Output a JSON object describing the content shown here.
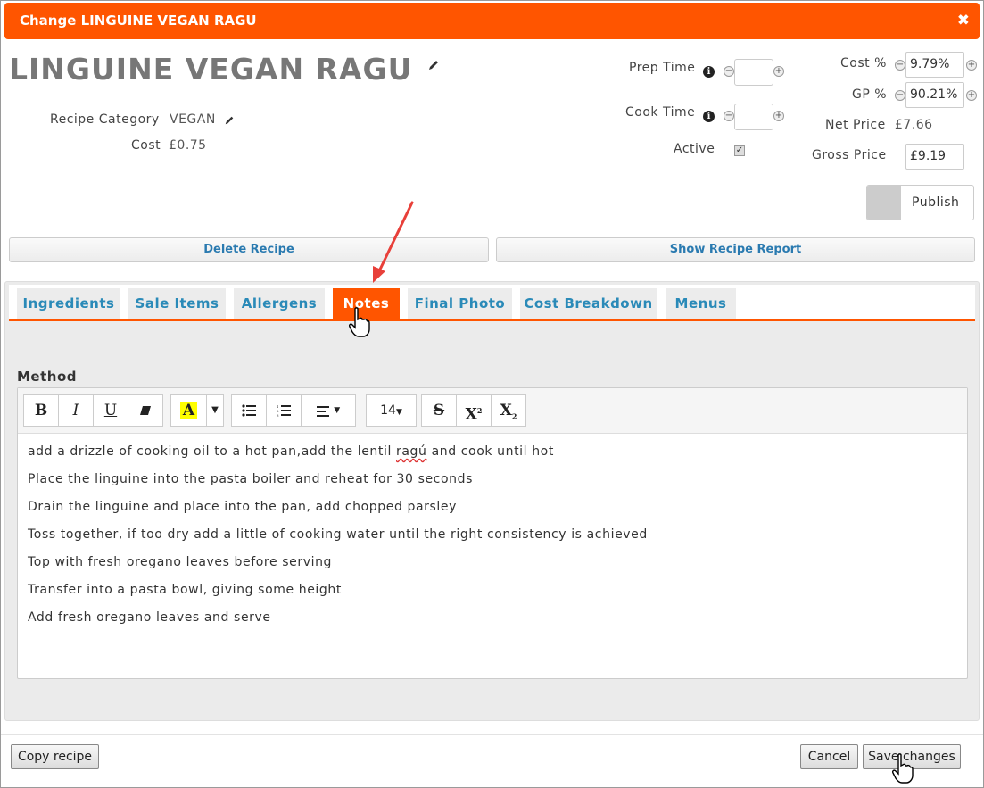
{
  "dialog": {
    "title": "Change LINGUINE VEGAN RAGU",
    "close_glyph": "✖"
  },
  "recipe": {
    "name": "LINGUINE VEGAN RAGU",
    "category_label": "Recipe Category",
    "category_value": "VEGAN",
    "cost_label": "Cost",
    "cost_value": "£0.75"
  },
  "timing": {
    "prep_label": "Prep Time",
    "prep_value": "",
    "cook_label": "Cook Time",
    "cook_value": "",
    "active_label": "Active",
    "active_checked": true
  },
  "pricing": {
    "cost_pct_label": "Cost %",
    "cost_pct_value": "9.79%",
    "gp_pct_label": "GP %",
    "gp_pct_value": "90.21%",
    "net_price_label": "Net Price",
    "net_price_value": "£7.66",
    "gross_price_label": "Gross Price",
    "gross_price_value": "£9.19"
  },
  "publish": {
    "label": "Publish"
  },
  "actions": {
    "delete": "Delete Recipe",
    "report": "Show Recipe Report"
  },
  "tabs": [
    {
      "label": "Ingredients",
      "active": false
    },
    {
      "label": "Sale Items",
      "active": false
    },
    {
      "label": "Allergens",
      "active": false
    },
    {
      "label": "Notes",
      "active": true
    },
    {
      "label": "Final Photo",
      "active": false
    },
    {
      "label": "Cost Breakdown",
      "active": false
    },
    {
      "label": "Menus",
      "active": false
    }
  ],
  "editor": {
    "label": "Method",
    "font_size": "14",
    "highlight_color": "#ffff00",
    "lines": [
      "add a drizzle of cooking oil to a hot pan,add the lentil ",
      "Place the linguine into the pasta boiler and reheat for 30 seconds",
      "Drain the linguine and place into the pan, add chopped parsley",
      "Toss together, if too dry add a little of cooking water until the right consistency is achieved",
      "Top with fresh oregano leaves before serving",
      "Transfer into a pasta bowl, giving some height",
      "Add fresh oregano leaves and serve"
    ],
    "line1_misspelled": "ragú",
    "line1_tail": " and cook until hot"
  },
  "footer": {
    "copy": "Copy recipe",
    "cancel": "Cancel",
    "save": "Save changes"
  },
  "colors": {
    "accent": "#ff5500",
    "tab_text": "#2a8ab8",
    "link_text": "#2a7ab0",
    "annotation_arrow": "#e8403a"
  }
}
